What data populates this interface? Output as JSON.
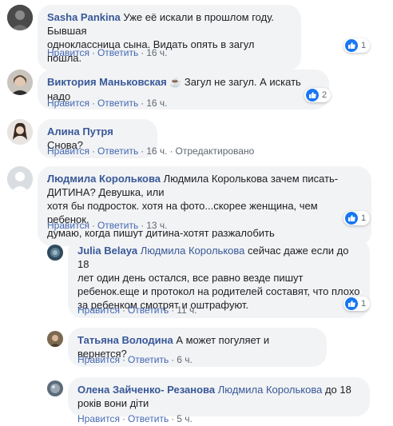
{
  "labels": {
    "like": "Нравится",
    "reply": "Ответить",
    "edited": "Отредактировано"
  },
  "comments": [
    {
      "author": "Sasha Pankina",
      "lines": [
        "Уже её искали в прошлом году. Бывшая",
        "одноклассница сына. Видать опять в загул пошла."
      ],
      "time": "16 ч.",
      "reactions": "1"
    },
    {
      "author": "Виктория Маньковская",
      "emoji": "☕",
      "text": "Загул не загул. А искать надо",
      "time": "16 ч.",
      "reactions": "2"
    },
    {
      "author": "Алина Путря",
      "text": "Снова?",
      "time": "16 ч."
    },
    {
      "author": "Людмила Королькова",
      "lines": [
        "Людмила Королькова зачем писать- ДИТИНА? Девушка, или",
        "хотя бы подросток. хотя на фото...скорее женщина, чем ребенок.",
        "думаю, когда пишут дитина-хотят разжалобить"
      ],
      "time": "13 ч.",
      "reactions": "1"
    },
    {
      "author": "Julia Belaya",
      "mention": "Людмила Королькова",
      "lines": [
        "сейчас даже если до 18",
        "лет один день остался, все равно везде пишут",
        "ребенок.еще и протокол на родителей составят, что плохо",
        "за ребенком смотрят и оштрафуют."
      ],
      "time": "11 ч.",
      "reactions": "1"
    },
    {
      "author": "Татьяна Володина",
      "text": "А может погуляет и вернется?",
      "time": "6 ч."
    },
    {
      "author": "Олена Зайченко- Резанова",
      "mention": "Людмила Королькова",
      "lines": [
        "до 18",
        "років вони діти"
      ],
      "time": "5 ч."
    }
  ]
}
